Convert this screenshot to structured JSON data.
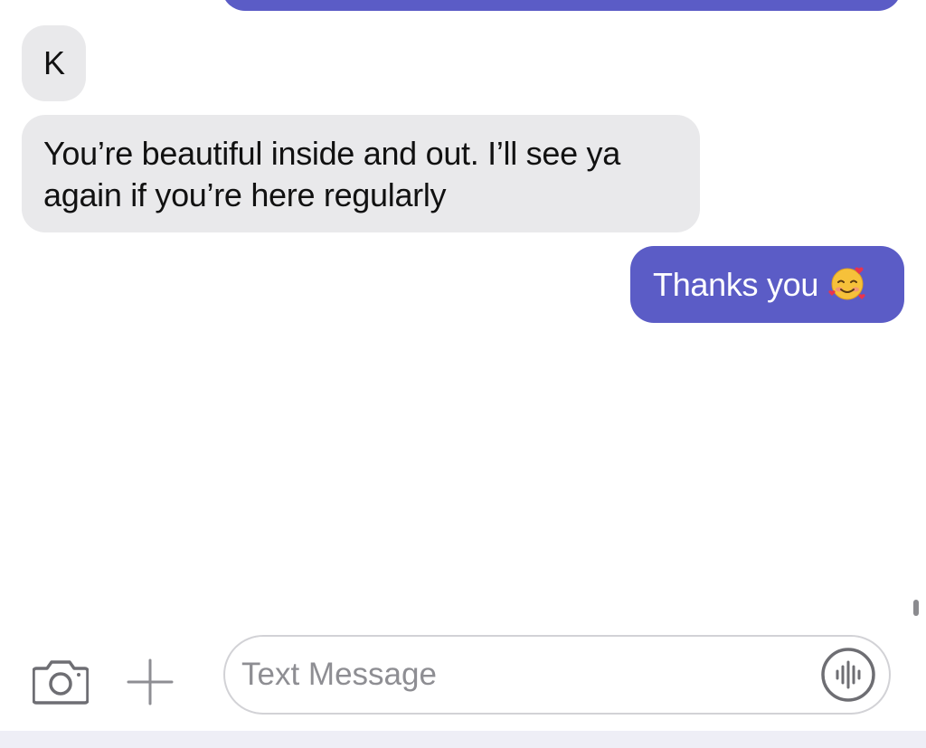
{
  "colors": {
    "sent_bubble": "#5b5cc6",
    "received_bubble": "#e9e9eb",
    "received_text": "#111111",
    "sent_text": "#ffffff",
    "placeholder": "#8e8e93",
    "icon": "#6e6e73"
  },
  "messages": [
    {
      "direction": "received",
      "text": "K"
    },
    {
      "direction": "received",
      "text": "You’re beautiful inside and out.  I’ll see ya again if you’re here regularly"
    },
    {
      "direction": "sent",
      "text": "Thanks you",
      "emoji": "smiling-face-with-hearts"
    }
  ],
  "composer": {
    "placeholder": "Text Message",
    "value": "",
    "camera_icon": "camera-icon",
    "plus_icon": "plus-icon",
    "audio_icon": "audio-waveform-icon"
  }
}
